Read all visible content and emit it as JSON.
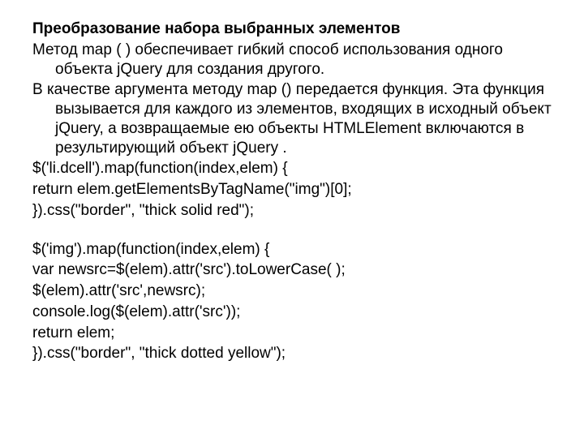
{
  "title": "Преобразование набора выбранных элементов",
  "para1": "Метод map ( ) обеспечивает гибкий способ использования одного объекта jQuery для создания другого.",
  "para2": "В качестве аргумента методу map () передается функция. Эта функция вызывается для каждого из элементов, входящих в исходный объект jQuery, а возвращаемые ею объекты HTMLElement включаются в результирующий объект jQuery .",
  "code1": [
    "$('li.dcell').map(function(index,elem) {",
    "return elem.getElementsByTagName(\"img\")[0];",
    "}).css(\"border\", \"thick solid red\");"
  ],
  "code2": [
    "$('img').map(function(index,elem) {",
    "var newsrc=$(elem).attr('src').toLowerCase( );",
    "$(elem).attr('src',newsrc);",
    "console.log($(elem).attr('src'));",
    "return elem;",
    "}).css(\"border\", \"thick dotted yellow\");"
  ]
}
